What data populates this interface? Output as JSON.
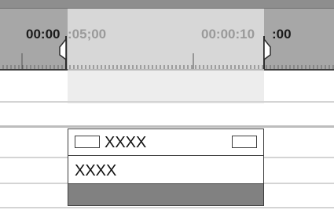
{
  "ruler": {
    "in_point_timecode": {
      "bold_part": "00:00",
      "dim_part": ":05;00"
    },
    "out_point_timecode": {
      "dim_part": "00:00:10",
      "bold_part": ":00"
    }
  },
  "clip": {
    "header_label": "XXXX",
    "secondary_label": "XXXX"
  },
  "colors": {
    "ruler_bg": "#a7a7a7",
    "range_bg": "#d7d7d7",
    "clip_footer": "#818181"
  },
  "icons": [
    "in-point-marker-icon",
    "out-point-marker-icon",
    "clip-box-icon",
    "clip-end-box-icon"
  ]
}
